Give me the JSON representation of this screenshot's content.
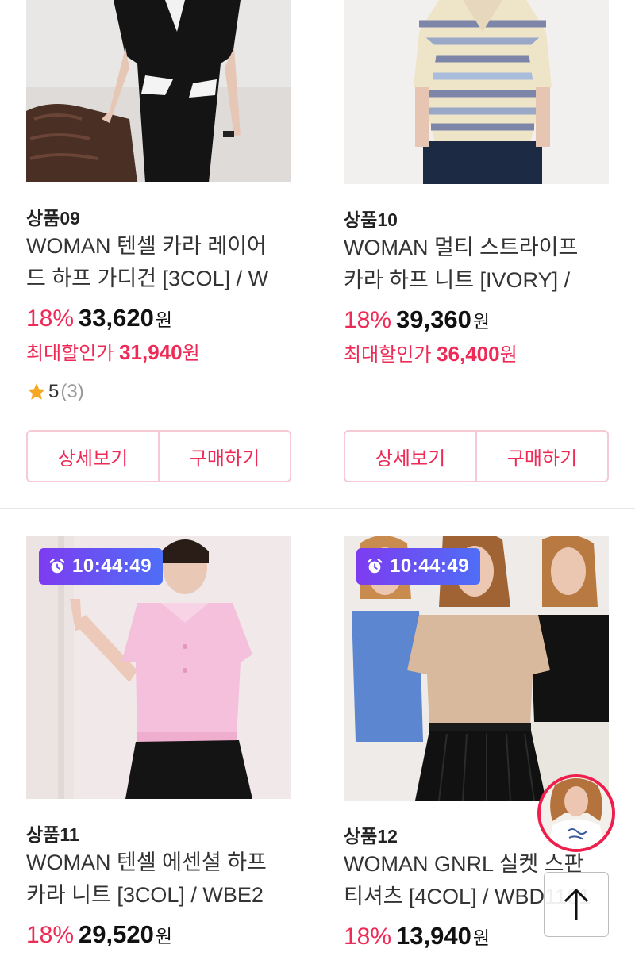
{
  "products": [
    {
      "code": "상품09",
      "title_lines": [
        "WOMAN 텐셀 카라 레이어",
        "드 하프 가디건 [3COL] / W"
      ],
      "discount": "18%",
      "price": "33,620",
      "won": "원",
      "max_sale_label": "최대할인가",
      "max_sale_price": "31,940",
      "max_sale_won": "원",
      "rating": "5",
      "review_count": "(3)",
      "detail_label": "상세보기",
      "buy_label": "구매하기"
    },
    {
      "code": "상품10",
      "title_lines": [
        "WOMAN 멀티 스트라이프",
        "카라 하프 니트 [IVORY] /"
      ],
      "discount": "18%",
      "price": "39,360",
      "won": "원",
      "max_sale_label": "최대할인가",
      "max_sale_price": "36,400",
      "max_sale_won": "원",
      "detail_label": "상세보기",
      "buy_label": "구매하기"
    },
    {
      "code": "상품11",
      "timer": "10:44:49",
      "title_lines": [
        "WOMAN 텐셀 에센셜 하프",
        "카라 니트 [3COL] / WBE2"
      ],
      "discount": "18%",
      "price": "29,520",
      "won": "원"
    },
    {
      "code": "상품12",
      "timer": "10:44:49",
      "title_lines": [
        "WOMAN GNRL 실켓 스판",
        "티셔츠 [4COL] / WBD1101"
      ],
      "discount": "18%",
      "price": "13,940",
      "won": "원"
    }
  ],
  "icons": {
    "star": "star-icon",
    "alarm": "alarm-clock-icon",
    "scroll_top": "arrow-up-icon"
  },
  "colors": {
    "accent": "#ee2a56",
    "timer_gradient_start": "#7d3cf0",
    "timer_gradient_end": "#4f6ef7",
    "star": "#f5a623"
  }
}
